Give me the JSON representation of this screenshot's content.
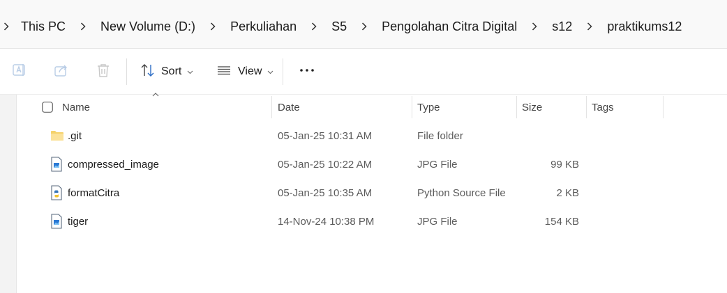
{
  "breadcrumb": {
    "items": [
      "This PC",
      "New Volume (D:)",
      "Perkuliahan",
      "S5",
      "Pengolahan Citra Digital",
      "s12",
      "praktikums12"
    ]
  },
  "toolbar": {
    "rename_icon": "rename-icon",
    "share_icon": "share-icon",
    "delete_icon": "trash-icon",
    "sort_label": "Sort",
    "view_label": "View",
    "more_icon": "more-icon"
  },
  "columns": {
    "name": "Name",
    "date": "Date",
    "type": "Type",
    "size": "Size",
    "tags": "Tags"
  },
  "files": [
    {
      "name": ".git",
      "date": "05-Jan-25 10:31 AM",
      "type": "File folder",
      "size": "",
      "icon": "folder-icon"
    },
    {
      "name": "compressed_image",
      "date": "05-Jan-25 10:22 AM",
      "type": "JPG File",
      "size": "99 KB",
      "icon": "image-file-icon"
    },
    {
      "name": "formatCitra",
      "date": "05-Jan-25 10:35 AM",
      "type": "Python Source File",
      "size": "2 KB",
      "icon": "python-file-icon"
    },
    {
      "name": "tiger",
      "date": "14-Nov-24 10:38 PM",
      "type": "JPG File",
      "size": "154 KB",
      "icon": "image-file-icon"
    }
  ]
}
